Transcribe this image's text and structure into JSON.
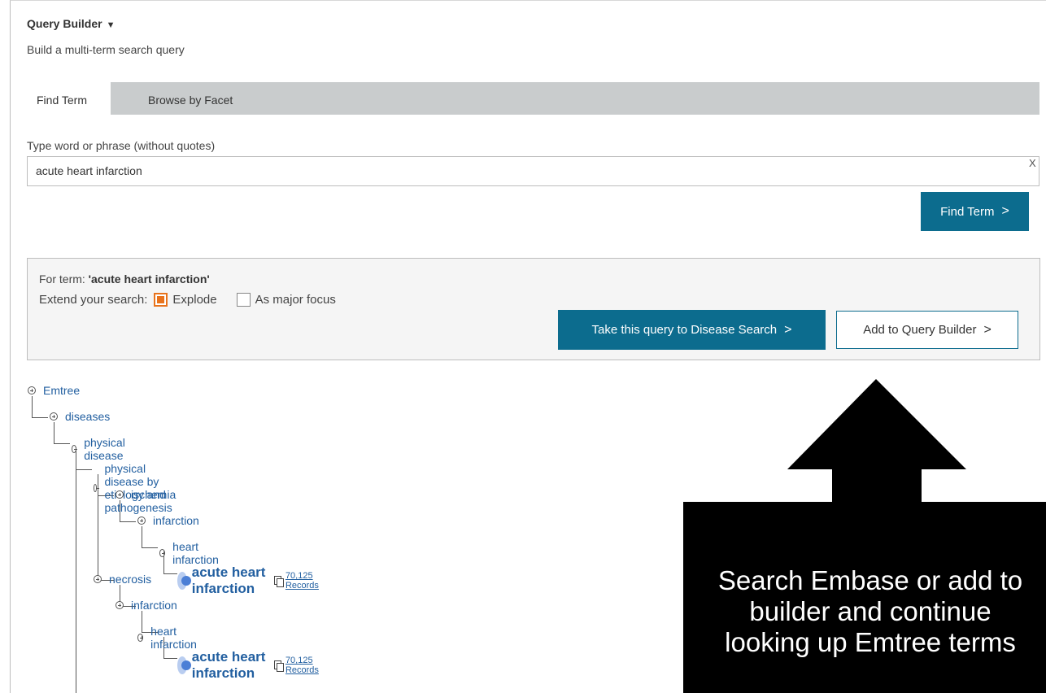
{
  "header": {
    "title": "Query Builder",
    "caret": "▼",
    "subtitle": "Build a multi-term search query"
  },
  "tabs": [
    {
      "label": "Find Term",
      "active": true
    },
    {
      "label": "Browse by Facet",
      "active": false
    }
  ],
  "search": {
    "label": "Type word or phrase (without quotes)",
    "value": "acute heart infarction",
    "clear_label": "X",
    "button_label": "Find Term"
  },
  "result": {
    "for_term_prefix": "For term: ",
    "term": "'acute heart infarction'",
    "extend_label": "Extend your search:",
    "options": [
      {
        "label": "Explode",
        "checked": true
      },
      {
        "label": "As major focus",
        "checked": false
      }
    ],
    "disease_button": "Take this query to Disease Search",
    "add_button": "Add to Query Builder"
  },
  "tree": {
    "nodes": [
      "Emtree",
      "diseases",
      "physical disease",
      "physical disease by etiology and pathogenesis",
      "ischemia",
      "infarction",
      "heart infarction",
      "acute heart infarction",
      "necrosis",
      "infarction",
      "heart infarction",
      "acute heart infarction"
    ],
    "records": [
      "70,125 Records",
      "70,125 Records"
    ]
  },
  "callout": {
    "text": "Search Embase or add to\nbuilder and continue\nlooking up Emtree terms"
  },
  "colors": {
    "primary": "#0c6c8e",
    "tab_bar": "#c9cccd",
    "checkbox": "#e8731c",
    "link": "#225fa0"
  }
}
